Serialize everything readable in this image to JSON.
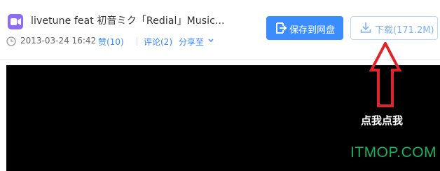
{
  "file": {
    "icon": "video-file-icon",
    "title": "livetune feat 初音ミク「Redial」Music...",
    "date": "2013-03-24 16:42",
    "like_label": "赞(10)",
    "comment_label": "评论(2)",
    "share_label": "分享至"
  },
  "actions": {
    "save_label": "保存到网盘",
    "download_label": "下载(171.2M)"
  },
  "annotation": {
    "text": "点我点我",
    "arrow_color": "#e0242b"
  },
  "watermark": "ITMOP.COM",
  "colors": {
    "accent": "#3b8cff",
    "player_bg": "#000000",
    "watermark": "#17b25c"
  }
}
